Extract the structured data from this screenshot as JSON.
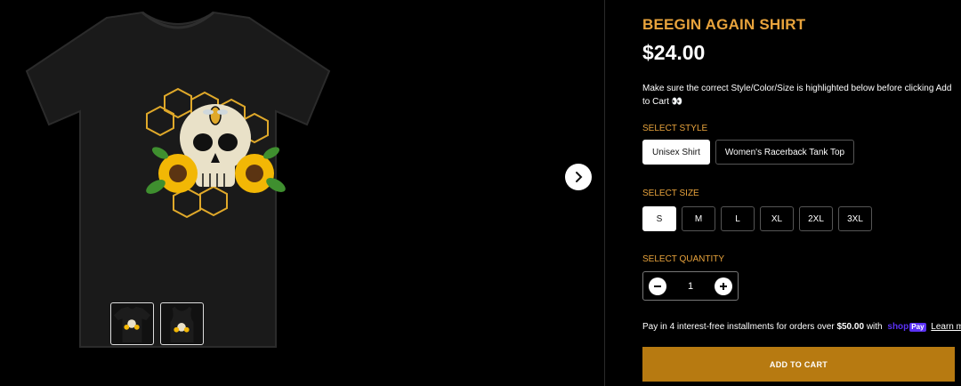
{
  "product": {
    "title": "BEEGIN AGAIN SHIRT",
    "price": "$24.00",
    "notice": "Make sure the correct Style/Color/Size is highlighted below before clicking Add to Cart 👀"
  },
  "style": {
    "label": "SELECT STYLE",
    "options": [
      "Unisex Shirt",
      "Women's Racerback Tank Top"
    ],
    "selected": "Unisex Shirt"
  },
  "size": {
    "label": "SELECT SIZE",
    "options": [
      "S",
      "M",
      "L",
      "XL",
      "2XL",
      "3XL"
    ],
    "selected": "S"
  },
  "quantity": {
    "label": "SELECT QUANTITY",
    "value": "1"
  },
  "installments": {
    "text_before": "Pay in 4 interest-free installments for orders over",
    "amount": "$50.00",
    "text_with": "with",
    "shop_text": "shop",
    "pay_text": "Pay",
    "learn_more": "Learn more"
  },
  "cart": {
    "add_label": "ADD TO CART"
  },
  "colors": {
    "accent": "#e8a33c",
    "button": "#b77a11",
    "shop_pay": "#5a31f4"
  },
  "icons": {
    "next": "chevron-right-icon",
    "minus": "minus-icon",
    "plus": "plus-icon"
  }
}
